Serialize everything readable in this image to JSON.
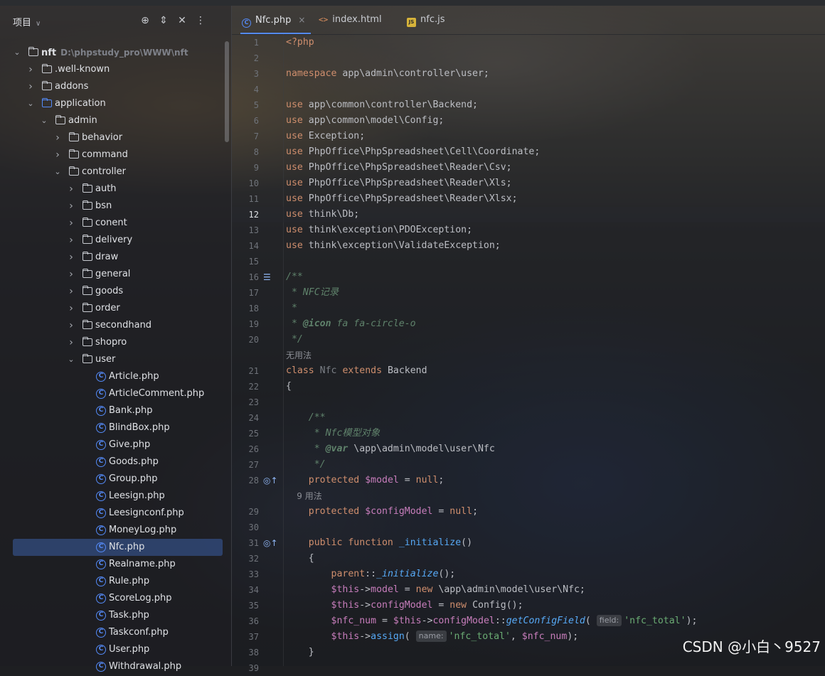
{
  "sidebar": {
    "title": "项目",
    "tree": [
      {
        "label": "nft",
        "path": "D:\\phpstudy_pro\\WWW\\nft",
        "type": "folder",
        "depth": 0,
        "expanded": true,
        "bold": true
      },
      {
        "label": ".well-known",
        "type": "folder",
        "depth": 1,
        "expanded": false
      },
      {
        "label": "addons",
        "type": "folder",
        "depth": 1,
        "expanded": false
      },
      {
        "label": "application",
        "type": "folder-blue",
        "depth": 1,
        "expanded": true
      },
      {
        "label": "admin",
        "type": "folder",
        "depth": 2,
        "expanded": true
      },
      {
        "label": "behavior",
        "type": "folder",
        "depth": 3,
        "expanded": false
      },
      {
        "label": "command",
        "type": "folder",
        "depth": 3,
        "expanded": false
      },
      {
        "label": "controller",
        "type": "folder",
        "depth": 3,
        "expanded": true
      },
      {
        "label": "auth",
        "type": "folder",
        "depth": 4,
        "expanded": false
      },
      {
        "label": "bsn",
        "type": "folder",
        "depth": 4,
        "expanded": false
      },
      {
        "label": "conent",
        "type": "folder",
        "depth": 4,
        "expanded": false
      },
      {
        "label": "delivery",
        "type": "folder",
        "depth": 4,
        "expanded": false
      },
      {
        "label": "draw",
        "type": "folder",
        "depth": 4,
        "expanded": false
      },
      {
        "label": "general",
        "type": "folder",
        "depth": 4,
        "expanded": false
      },
      {
        "label": "goods",
        "type": "folder",
        "depth": 4,
        "expanded": false
      },
      {
        "label": "order",
        "type": "folder",
        "depth": 4,
        "expanded": false
      },
      {
        "label": "secondhand",
        "type": "folder",
        "depth": 4,
        "expanded": false
      },
      {
        "label": "shopro",
        "type": "folder",
        "depth": 4,
        "expanded": false
      },
      {
        "label": "user",
        "type": "folder",
        "depth": 4,
        "expanded": true
      },
      {
        "label": "Article.php",
        "type": "class",
        "depth": 5
      },
      {
        "label": "ArticleComment.php",
        "type": "class",
        "depth": 5
      },
      {
        "label": "Bank.php",
        "type": "class",
        "depth": 5
      },
      {
        "label": "BlindBox.php",
        "type": "class",
        "depth": 5
      },
      {
        "label": "Give.php",
        "type": "class",
        "depth": 5
      },
      {
        "label": "Goods.php",
        "type": "class",
        "depth": 5
      },
      {
        "label": "Group.php",
        "type": "class",
        "depth": 5
      },
      {
        "label": "Leesign.php",
        "type": "class",
        "depth": 5
      },
      {
        "label": "Leesignconf.php",
        "type": "class",
        "depth": 5
      },
      {
        "label": "MoneyLog.php",
        "type": "class",
        "depth": 5
      },
      {
        "label": "Nfc.php",
        "type": "class",
        "depth": 5,
        "selected": true
      },
      {
        "label": "Realname.php",
        "type": "class",
        "depth": 5
      },
      {
        "label": "Rule.php",
        "type": "class",
        "depth": 5
      },
      {
        "label": "ScoreLog.php",
        "type": "class",
        "depth": 5
      },
      {
        "label": "Task.php",
        "type": "class",
        "depth": 5
      },
      {
        "label": "Taskconf.php",
        "type": "class",
        "depth": 5
      },
      {
        "label": "User.php",
        "type": "class",
        "depth": 5
      },
      {
        "label": "Withdrawal.php",
        "type": "class",
        "depth": 5
      }
    ]
  },
  "tabs": [
    {
      "label": "Nfc.php",
      "icon": "php-class-icon",
      "active": true,
      "closable": true
    },
    {
      "label": "index.html",
      "icon": "html-icon",
      "active": false
    },
    {
      "label": "nfc.js",
      "icon": "js-icon",
      "active": false
    }
  ],
  "current_line": "12",
  "editor_lines": [
    {
      "n": "1",
      "html": "<span class='phptag'>&lt;?php</span>"
    },
    {
      "n": "2",
      "html": ""
    },
    {
      "n": "3",
      "html": "<span class='kw'>namespace</span> app\\admin\\controller\\user;"
    },
    {
      "n": "4",
      "html": ""
    },
    {
      "n": "5",
      "html": "<span class='kw'>use</span> app\\common\\controller\\Backend;"
    },
    {
      "n": "6",
      "html": "<span class='kw'>use</span> app\\common\\model\\Config;"
    },
    {
      "n": "7",
      "html": "<span class='kw'>use</span> Exception;"
    },
    {
      "n": "8",
      "html": "<span class='kw'>use</span> PhpOffice\\PhpSpreadsheet\\Cell\\Coordinate;"
    },
    {
      "n": "9",
      "html": "<span class='kw'>use</span> PhpOffice\\PhpSpreadsheet\\Reader\\Csv;"
    },
    {
      "n": "10",
      "html": "<span class='kw'>use</span> PhpOffice\\PhpSpreadsheet\\Reader\\Xls;"
    },
    {
      "n": "11",
      "html": "<span class='kw'>use</span> PhpOffice\\PhpSpreadsheet\\Reader\\Xlsx;"
    },
    {
      "n": "12",
      "html": "<span class='kw'>use</span> think\\Db;"
    },
    {
      "n": "13",
      "html": "<span class='kw'>use</span> think\\exception\\PDOException;"
    },
    {
      "n": "14",
      "html": "<span class='kw'>use</span> think\\exception\\ValidateException;"
    },
    {
      "n": "15",
      "html": ""
    },
    {
      "n": "16",
      "html": "<span class='doc'>/**</span>",
      "gutter_icon": "doc-render-icon"
    },
    {
      "n": "17",
      "html": "<span class='doc'> * NFC记录</span>"
    },
    {
      "n": "18",
      "html": "<span class='doc'> *</span>"
    },
    {
      "n": "19",
      "html": "<span class='doc'> * </span><span class='tag'>@icon</span><span class='doc'> fa fa-circle-o</span>"
    },
    {
      "n": "20",
      "html": "<span class='doc'> */</span>"
    },
    {
      "hint": "无用法"
    },
    {
      "n": "21",
      "html": "<span class='kw'>class</span> <span class='cmt' style='font-style:normal'>Nfc</span> <span class='kw'>extends</span> Backend"
    },
    {
      "n": "22",
      "html": "{"
    },
    {
      "n": "23",
      "html": ""
    },
    {
      "n": "24",
      "html": "    <span class='doc'>/**</span>"
    },
    {
      "n": "25",
      "html": "<span class='doc'>     * Nfc模型对象</span>"
    },
    {
      "n": "26",
      "html": "<span class='doc'>     * </span><span class='tag'>@var</span><span class='doc' style='font-style:normal;color:#bcbec4'> \\app\\admin\\model\\user\\Nfc</span>"
    },
    {
      "n": "27",
      "html": "<span class='doc'>     */</span>"
    },
    {
      "n": "28",
      "html": "    <span class='kw'>protected</span> <span class='var'>$model</span> = <span class='kw'>null</span>;",
      "gutter_icon": "override-icon"
    },
    {
      "hint": "    9 用法"
    },
    {
      "n": "29",
      "html": "    <span class='kw'>protected</span> <span class='var'>$configModel</span> = <span class='kw'>null</span>;"
    },
    {
      "n": "30",
      "html": ""
    },
    {
      "n": "31",
      "html": "    <span class='kw'>public function</span> <span class='call'>_initialize</span>()",
      "gutter_icon": "override-icon"
    },
    {
      "n": "32",
      "html": "    {"
    },
    {
      "n": "33",
      "html": "        <span class='kw'>parent</span>::<span class='fn'>_initialize</span>();"
    },
    {
      "n": "34",
      "html": "        <span class='var'>$this</span>-&gt;<span class='var'>model</span> = <span class='kw'>new</span> \\app\\admin\\model\\user\\Nfc;"
    },
    {
      "n": "35",
      "html": "        <span class='var'>$this</span>-&gt;<span class='var'>configModel</span> = <span class='kw'>new</span> Config();"
    },
    {
      "n": "36",
      "html": "        <span class='var'>$nfc_num</span> = <span class='var'>$this</span>-&gt;<span class='var'>configModel</span>::<span class='fn'>getConfigField</span>( <span class='inlay'>field:</span><span class='str'>'nfc_total'</span>);"
    },
    {
      "n": "37",
      "html": "        <span class='var'>$this</span>-&gt;<span class='call'>assign</span>( <span class='inlay'>name:</span><span class='str'>'nfc_total'</span>, <span class='var'>$nfc_num</span>);"
    },
    {
      "n": "38",
      "html": "    }"
    },
    {
      "n": "39",
      "html": ""
    }
  ],
  "watermark": "CSDN @小白丶9527"
}
